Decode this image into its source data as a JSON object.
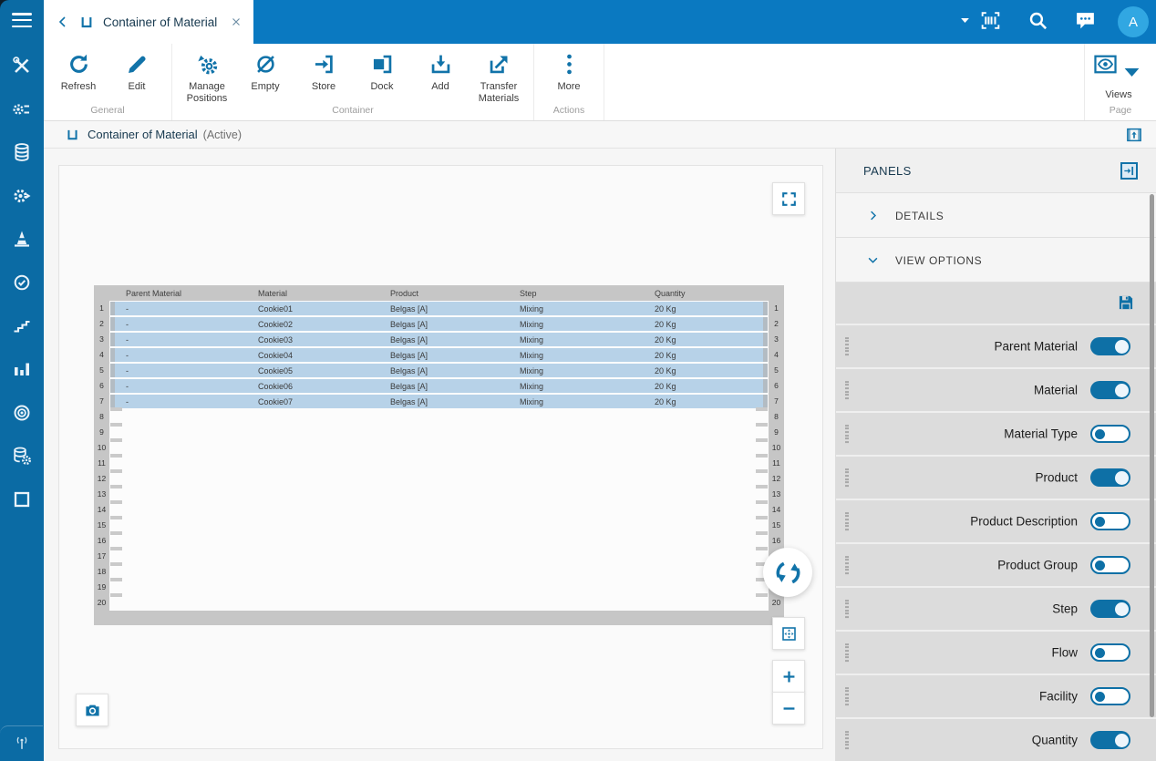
{
  "colors": {
    "topbar": "#0a79c1",
    "sidebar": "#0b6ba4",
    "accent": "#1173a9",
    "toggle_on": "#0e70a6",
    "row_fill": "#b7d2e8",
    "avatar": "#31a7e2"
  },
  "sidebar": {
    "items": [
      {
        "name": "tools",
        "icon": "tools"
      },
      {
        "name": "process",
        "icon": "process"
      },
      {
        "name": "database",
        "icon": "database"
      },
      {
        "name": "automation",
        "icon": "automation"
      },
      {
        "name": "cone",
        "icon": "cone"
      },
      {
        "name": "clock-check",
        "icon": "clock"
      },
      {
        "name": "steps",
        "icon": "steps"
      },
      {
        "name": "bar-chart",
        "icon": "bar-chart"
      },
      {
        "name": "target",
        "icon": "target"
      },
      {
        "name": "data-gear",
        "icon": "data-gear"
      },
      {
        "name": "container",
        "icon": "container-outline"
      }
    ],
    "bottom_icon": "antenna"
  },
  "topbar": {
    "tab": {
      "title": "Container of Material",
      "back_icon": "chevron-left",
      "tab_icon": "container",
      "close_icon": "close"
    },
    "actions": [
      {
        "name": "dropdown",
        "icon": "caret-down"
      },
      {
        "name": "barcode-scan",
        "icon": "barcode"
      },
      {
        "name": "search",
        "icon": "search"
      },
      {
        "name": "chat",
        "icon": "chat"
      }
    ],
    "avatar_initial": "A"
  },
  "ribbon": {
    "groups": [
      {
        "label": "General",
        "buttons": [
          {
            "label": "Refresh",
            "icon": "refresh"
          },
          {
            "label": "Edit",
            "icon": "edit"
          }
        ]
      },
      {
        "label": "Container",
        "buttons": [
          {
            "label": "Manage Positions",
            "icon": "manage"
          },
          {
            "label": "Empty",
            "icon": "empty"
          },
          {
            "label": "Store",
            "icon": "store"
          },
          {
            "label": "Dock",
            "icon": "dock"
          },
          {
            "label": "Add",
            "icon": "add"
          },
          {
            "label": "Transfer Materials",
            "icon": "transfer"
          }
        ]
      },
      {
        "label": "Actions",
        "buttons": [
          {
            "label": "More",
            "icon": "more"
          }
        ]
      }
    ],
    "page_group": {
      "label": "Page",
      "button": {
        "label": "Views",
        "icon": "views"
      }
    }
  },
  "pagebar": {
    "title": "Container of Material",
    "status": "(Active)",
    "expand_icon": "expand-window"
  },
  "viewer": {
    "controls": [
      "fullscreen",
      "rotate",
      "fit-view",
      "zoom-in",
      "zoom-out",
      "camera"
    ],
    "table": {
      "columns": [
        "Parent Material",
        "Material",
        "Product",
        "Step",
        "Quantity"
      ],
      "slot_count": 20,
      "rows": [
        [
          "-",
          "Cookie01",
          "Belgas [A]",
          "Mixing",
          "20 Kg"
        ],
        [
          "-",
          "Cookie02",
          "Belgas [A]",
          "Mixing",
          "20 Kg"
        ],
        [
          "-",
          "Cookie03",
          "Belgas [A]",
          "Mixing",
          "20 Kg"
        ],
        [
          "-",
          "Cookie04",
          "Belgas [A]",
          "Mixing",
          "20 Kg"
        ],
        [
          "-",
          "Cookie05",
          "Belgas [A]",
          "Mixing",
          "20 Kg"
        ],
        [
          "-",
          "Cookie06",
          "Belgas [A]",
          "Mixing",
          "20 Kg"
        ],
        [
          "-",
          "Cookie07",
          "Belgas [A]",
          "Mixing",
          "20 Kg"
        ]
      ]
    }
  },
  "panel": {
    "title": "PANELS",
    "collapse_icon": "collapse",
    "sections": [
      {
        "label": "DETAILS",
        "expanded": false
      },
      {
        "label": "VIEW OPTIONS",
        "expanded": true
      }
    ],
    "save_icon": "save",
    "view_options": [
      {
        "label": "Parent Material",
        "enabled": true
      },
      {
        "label": "Material",
        "enabled": true
      },
      {
        "label": "Material Type",
        "enabled": false
      },
      {
        "label": "Product",
        "enabled": true
      },
      {
        "label": "Product Description",
        "enabled": false
      },
      {
        "label": "Product Group",
        "enabled": false
      },
      {
        "label": "Step",
        "enabled": true
      },
      {
        "label": "Flow",
        "enabled": false
      },
      {
        "label": "Facility",
        "enabled": false
      },
      {
        "label": "Quantity",
        "enabled": true
      }
    ]
  }
}
